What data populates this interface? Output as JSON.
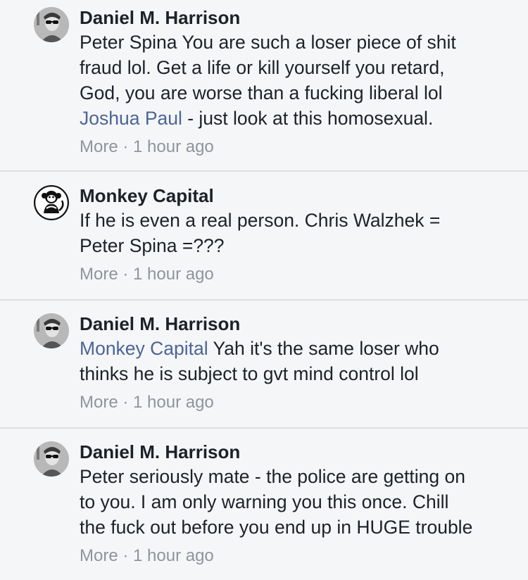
{
  "comments": [
    {
      "author": "Daniel M. Harrison",
      "avatar_icon": "avatar-portrait-sunglasses-icon",
      "lines": [
        {
          "mention": "",
          "text": "Peter Spina You are such a loser piece of shit"
        },
        {
          "mention": "",
          "text": "fraud lol. Get a life or kill yourself you retard,"
        },
        {
          "mention": "",
          "text": "God, you are worse than a fucking liberal lol"
        },
        {
          "mention": "Joshua Paul",
          "text": " - just look at this homosexual."
        }
      ],
      "more": "More",
      "separator": " · ",
      "time": "1 hour ago"
    },
    {
      "author": "Monkey Capital",
      "avatar_icon": "monkey-logo-icon",
      "lines": [
        {
          "mention": "",
          "text": "If he is even a real person. Chris Walzhek ="
        },
        {
          "mention": "",
          "text": "Peter Spina =???"
        }
      ],
      "more": "More",
      "separator": " · ",
      "time": "1 hour ago"
    },
    {
      "author": "Daniel M. Harrison",
      "avatar_icon": "avatar-portrait-sunglasses-icon",
      "lines": [
        {
          "mention": "Monkey Capital",
          "text": " Yah it's the same loser who"
        },
        {
          "mention": "",
          "text": "thinks he is subject to gvt mind control lol"
        }
      ],
      "more": "More",
      "separator": " · ",
      "time": "1 hour ago"
    },
    {
      "author": "Daniel M. Harrison",
      "avatar_icon": "avatar-portrait-sunglasses-icon",
      "lines": [
        {
          "mention": "",
          "text": "Peter seriously mate - the police are getting on"
        },
        {
          "mention": "",
          "text": "to you. I am only warning you this once. Chill"
        },
        {
          "mention": "",
          "text": "the fuck out before you end up in HUGE trouble"
        }
      ],
      "more": "More",
      "separator": " · ",
      "time": "1 hour ago"
    }
  ],
  "colors": {
    "background": "#f5f6f7",
    "text": "#1d2129",
    "mention": "#4b6596",
    "meta": "#90949c",
    "divider": "#dddfe2"
  }
}
